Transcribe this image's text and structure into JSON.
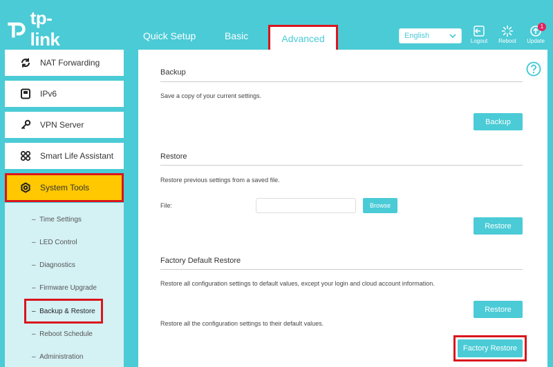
{
  "brand": {
    "logo_text": "tp-link"
  },
  "nav": {
    "tabs": [
      {
        "label": "Quick Setup"
      },
      {
        "label": "Basic"
      },
      {
        "label": "Advanced"
      }
    ]
  },
  "language": {
    "selected": "English"
  },
  "top_actions": {
    "logout": "Logout",
    "reboot": "Reboot",
    "update": "Update",
    "update_badge": "1"
  },
  "sidebar": {
    "items": [
      {
        "label": "NAT Forwarding",
        "icon": "nat-forwarding-icon"
      },
      {
        "label": "IPv6",
        "icon": "ipv6-icon"
      },
      {
        "label": "VPN Server",
        "icon": "vpn-key-icon"
      },
      {
        "label": "Smart Life Assistant",
        "icon": "smart-life-icon"
      },
      {
        "label": "System Tools",
        "icon": "gear-icon"
      }
    ],
    "submenu": [
      {
        "label": "Time Settings"
      },
      {
        "label": "LED Control"
      },
      {
        "label": "Diagnostics"
      },
      {
        "label": "Firmware Upgrade"
      },
      {
        "label": "Backup & Restore"
      },
      {
        "label": "Reboot Schedule"
      },
      {
        "label": "Administration"
      }
    ]
  },
  "main": {
    "backup": {
      "title": "Backup",
      "desc": "Save a copy of your current settings.",
      "button": "Backup"
    },
    "restore": {
      "title": "Restore",
      "desc": "Restore previous settings from a saved file.",
      "file_label": "File:",
      "file_value": "",
      "browse": "Browse",
      "button": "Restore"
    },
    "factory": {
      "title": "Factory Default Restore",
      "desc1": "Restore all configuration settings to default values, except your login and cloud account information.",
      "button1": "Restore",
      "desc2": "Restore all the configuration settings to their default values.",
      "button2": "Factory Restore"
    }
  },
  "colors": {
    "accent": "#4acbd6",
    "highlight": "#ffc800",
    "annotation": "#d9151c"
  }
}
